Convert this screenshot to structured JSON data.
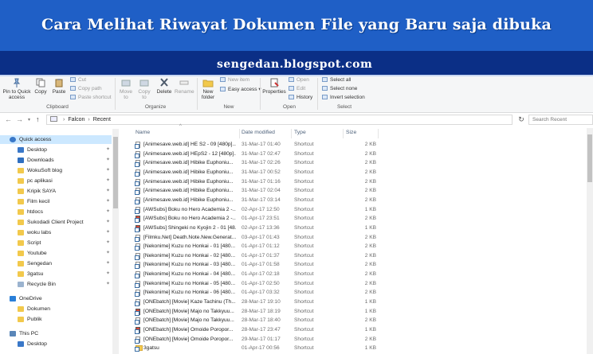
{
  "banner": {
    "title": "Cara Melihat Riwayat Dokumen File yang Baru saja dibuka",
    "url": "sengedan.blogspot.com"
  },
  "ribbon": {
    "pin_to_quick_access": "Pin to Quick access",
    "copy": "Copy",
    "paste": "Paste",
    "cut": "Cut",
    "copy_path": "Copy path",
    "paste_shortcut": "Paste shortcut",
    "move_to": "Move to",
    "copy_to": "Copy to",
    "delete": "Delete",
    "rename": "Rename",
    "new_folder": "New folder",
    "new_item": "New item",
    "easy_access": "Easy access",
    "properties": "Properties",
    "open": "Open",
    "edit": "Edit",
    "history": "History",
    "select_all": "Select all",
    "select_none": "Select none",
    "invert_selection": "Invert selection",
    "groups": {
      "clipboard": "Clipboard",
      "organize": "Organize",
      "new": "New",
      "open": "Open",
      "select": "Select"
    }
  },
  "address": {
    "crumbs": [
      "Falcon",
      "Recent"
    ],
    "search_placeholder": "Search Recent"
  },
  "nav": {
    "items": [
      {
        "label": "Quick access",
        "kind": "star",
        "indent": 0,
        "pinned": false,
        "selected": true
      },
      {
        "label": "Desktop",
        "kind": "desktop",
        "indent": 1,
        "pinned": true
      },
      {
        "label": "Downloads",
        "kind": "download",
        "indent": 1,
        "pinned": true
      },
      {
        "label": "WokuSoft blog",
        "kind": "folder",
        "indent": 1,
        "pinned": true
      },
      {
        "label": "pc aplikasi",
        "kind": "folder",
        "indent": 1,
        "pinned": true
      },
      {
        "label": "Kripik SAYA",
        "kind": "folder",
        "indent": 1,
        "pinned": true
      },
      {
        "label": "Film kecil",
        "kind": "folder",
        "indent": 1,
        "pinned": true
      },
      {
        "label": "htdocs",
        "kind": "folder",
        "indent": 1,
        "pinned": true
      },
      {
        "label": "Sukodadi Client Project",
        "kind": "folder",
        "indent": 1,
        "pinned": true
      },
      {
        "label": "woku labs",
        "kind": "folder",
        "indent": 1,
        "pinned": true
      },
      {
        "label": "Script",
        "kind": "folder",
        "indent": 1,
        "pinned": true
      },
      {
        "label": "Youtube",
        "kind": "folder",
        "indent": 1,
        "pinned": true
      },
      {
        "label": "Sengedan",
        "kind": "folder",
        "indent": 1,
        "pinned": true
      },
      {
        "label": "3gatsu",
        "kind": "folder",
        "indent": 1,
        "pinned": true
      },
      {
        "label": "Recycle Bin",
        "kind": "bin",
        "indent": 1,
        "pinned": true
      },
      {
        "label": "",
        "kind": "gap",
        "indent": 0,
        "pinned": false
      },
      {
        "label": "OneDrive",
        "kind": "cloud",
        "indent": 0,
        "pinned": false
      },
      {
        "label": "Dokumen",
        "kind": "folder",
        "indent": 1,
        "pinned": false
      },
      {
        "label": "Publik",
        "kind": "folder",
        "indent": 1,
        "pinned": false
      },
      {
        "label": "",
        "kind": "gap",
        "indent": 0,
        "pinned": false
      },
      {
        "label": "This PC",
        "kind": "pc",
        "indent": 0,
        "pinned": false
      },
      {
        "label": "Desktop",
        "kind": "desktop",
        "indent": 1,
        "pinned": false
      }
    ]
  },
  "list": {
    "columns": {
      "name": "Name",
      "date": "Date modified",
      "type": "Type",
      "size": "Size"
    },
    "rows": [
      {
        "name": "[Animesave.web.id] HE S2 - 09 [480p]...",
        "date": "31-Mar-17 01:40",
        "type": "Shortcut",
        "size": "2 KB",
        "icon": "file"
      },
      {
        "name": "[Animesave.web.id] HEpS2 - 12 [480p]...",
        "date": "31-Mar-17 02:47",
        "type": "Shortcut",
        "size": "2 KB",
        "icon": "file"
      },
      {
        "name": "[Animesave.web.id] Hibike Euphoniu...",
        "date": "31-Mar-17 02:26",
        "type": "Shortcut",
        "size": "2 KB",
        "icon": "file"
      },
      {
        "name": "[Animesave.web.id] Hibike Euphoniu...",
        "date": "31-Mar-17 00:52",
        "type": "Shortcut",
        "size": "2 KB",
        "icon": "file"
      },
      {
        "name": "[Animesave.web.id] Hibike Euphoniu...",
        "date": "31-Mar-17 01:16",
        "type": "Shortcut",
        "size": "2 KB",
        "icon": "file"
      },
      {
        "name": "[Animesave.web.id] Hibike Euphoniu...",
        "date": "31-Mar-17 02:04",
        "type": "Shortcut",
        "size": "2 KB",
        "icon": "file"
      },
      {
        "name": "[Animesave.web.id] Hibike Euphoniu...",
        "date": "31-Mar-17 03:14",
        "type": "Shortcut",
        "size": "2 KB",
        "icon": "file"
      },
      {
        "name": "[AWSubs] Boku no Hero Academia 2 -...",
        "date": "02-Apr-17 12:50",
        "type": "Shortcut",
        "size": "1 KB",
        "icon": "file"
      },
      {
        "name": "[AWSubs] Boku no Hero Academia 2 -...",
        "date": "01-Apr-17 23:51",
        "type": "Shortcut",
        "size": "2 KB",
        "icon": "rar"
      },
      {
        "name": "[AWSubs] Shingeki no Kyojin 2 - 01 [48...",
        "date": "02-Apr-17 13:36",
        "type": "Shortcut",
        "size": "1 KB",
        "icon": "rar"
      },
      {
        "name": "[Filmku.Net] Death.Note.New.Generat...",
        "date": "03-Apr-17 01:43",
        "type": "Shortcut",
        "size": "2 KB",
        "icon": "file"
      },
      {
        "name": "[Nekonime] Kuzu no Honkai - 01 [480...",
        "date": "01-Apr-17 01:12",
        "type": "Shortcut",
        "size": "2 KB",
        "icon": "file"
      },
      {
        "name": "[Nekonime] Kuzu no Honkai - 02 [480...",
        "date": "01-Apr-17 01:37",
        "type": "Shortcut",
        "size": "2 KB",
        "icon": "file"
      },
      {
        "name": "[Nekonime] Kuzu no Honkai - 03 [480...",
        "date": "01-Apr-17 01:58",
        "type": "Shortcut",
        "size": "2 KB",
        "icon": "file"
      },
      {
        "name": "[Nekonime] Kuzu no Honkai - 04 [480...",
        "date": "01-Apr-17 02:18",
        "type": "Shortcut",
        "size": "2 KB",
        "icon": "file"
      },
      {
        "name": "[Nekonime] Kuzu no Honkai - 05 [480...",
        "date": "01-Apr-17 02:50",
        "type": "Shortcut",
        "size": "2 KB",
        "icon": "file"
      },
      {
        "name": "[Nekonime] Kuzu no Honkai - 06 [480...",
        "date": "01-Apr-17 03:32",
        "type": "Shortcut",
        "size": "2 KB",
        "icon": "file"
      },
      {
        "name": "[ONEbatch] [Movie] Kaze Tachinu (Th...",
        "date": "28-Mar-17 19:10",
        "type": "Shortcut",
        "size": "1 KB",
        "icon": "file"
      },
      {
        "name": "[ONEbatch] [Movie] Majo no Takkyuu...",
        "date": "28-Mar-17 18:19",
        "type": "Shortcut",
        "size": "1 KB",
        "icon": "rar"
      },
      {
        "name": "[ONEbatch] [Movie] Majo no Takkyuu...",
        "date": "28-Mar-17 18:40",
        "type": "Shortcut",
        "size": "2 KB",
        "icon": "file"
      },
      {
        "name": "[ONEbatch] [Movie] Omoide Poropor...",
        "date": "28-Mar-17 23:47",
        "type": "Shortcut",
        "size": "1 KB",
        "icon": "rar"
      },
      {
        "name": "[ONEbatch] [Movie] Omoide Poropor...",
        "date": "29-Mar-17 01:17",
        "type": "Shortcut",
        "size": "2 KB",
        "icon": "file"
      },
      {
        "name": "3gatsu",
        "date": "01-Apr-17 00:56",
        "type": "Shortcut",
        "size": "1 KB",
        "icon": "folder"
      }
    ]
  }
}
